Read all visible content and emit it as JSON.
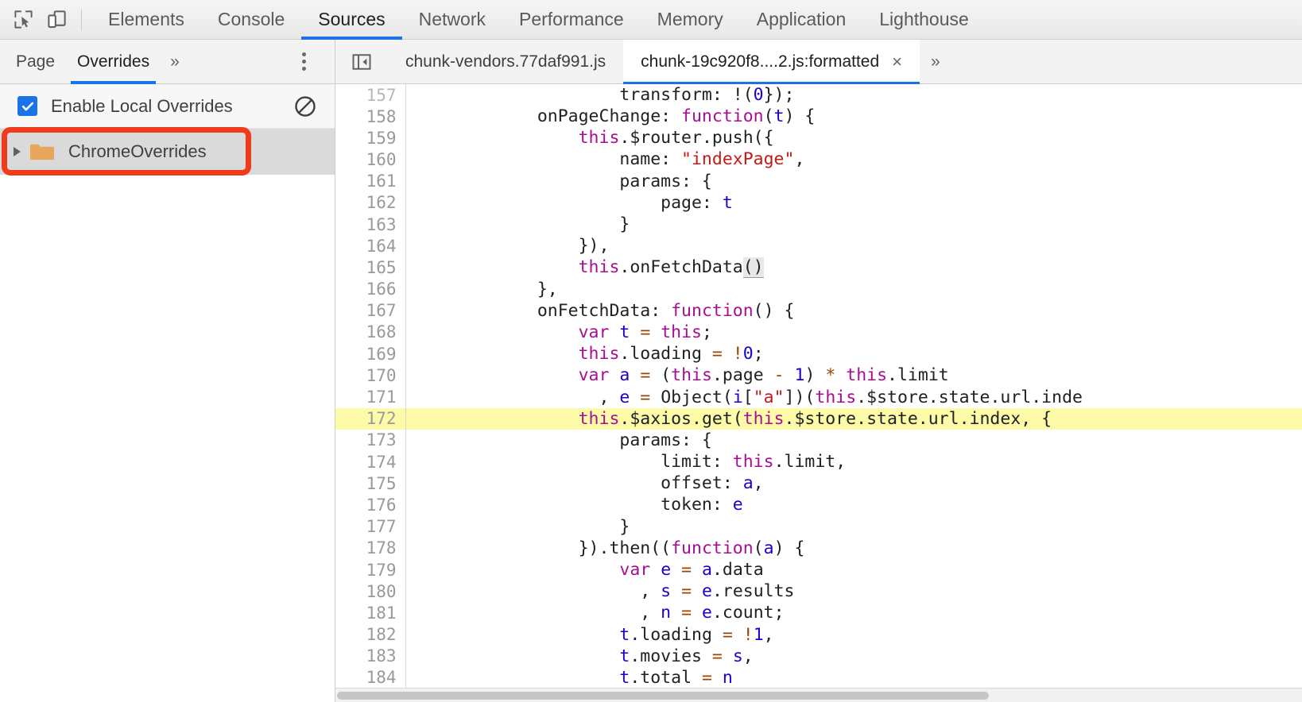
{
  "toolbar": {
    "inspect_icon": "inspect-element-icon",
    "device_icon": "device-toolbar-icon",
    "tabs": [
      {
        "label": "Elements",
        "active": false
      },
      {
        "label": "Console",
        "active": false
      },
      {
        "label": "Sources",
        "active": true
      },
      {
        "label": "Network",
        "active": false
      },
      {
        "label": "Performance",
        "active": false
      },
      {
        "label": "Memory",
        "active": false
      },
      {
        "label": "Application",
        "active": false
      },
      {
        "label": "Lighthouse",
        "active": false
      }
    ]
  },
  "sidebar": {
    "nav_tabs": [
      {
        "label": "Page",
        "active": false
      },
      {
        "label": "Overrides",
        "active": true
      }
    ],
    "more_tabs_label": "»",
    "menu_icon": "more-options-kebab-icon",
    "overrides": {
      "checkbox_label": "Enable Local Overrides",
      "checkbox_checked": true,
      "clear_icon": "clear-configuration-icon",
      "folder": {
        "name": "ChromeOverrides",
        "expanded": false,
        "selected": true,
        "icon": "folder-icon"
      }
    }
  },
  "editor": {
    "nav_back_icon": "show-navigator-icon",
    "tabs": [
      {
        "label": "chunk-vendors.77daf991.js",
        "active": false,
        "closable": false
      },
      {
        "label": "chunk-19c920f8....2.js:formatted",
        "active": true,
        "closable": true,
        "close_label": "×"
      }
    ],
    "overflow_label": "»",
    "highlighted_line": 172,
    "first_line": 157,
    "last_line": 184,
    "lines": [
      {
        "n": 157,
        "clipped": true,
        "tokens": [
          {
            "t": "                    transform: !(",
            "c": "plain"
          },
          {
            "t": "0",
            "c": "num"
          },
          {
            "t": "});",
            "c": "plain"
          }
        ]
      },
      {
        "n": 158,
        "tokens": [
          {
            "t": "            onPageChange: ",
            "c": "plain"
          },
          {
            "t": "function",
            "c": "kw"
          },
          {
            "t": "(",
            "c": "plain"
          },
          {
            "t": "t",
            "c": "idn"
          },
          {
            "t": ") {",
            "c": "plain"
          }
        ]
      },
      {
        "n": 159,
        "tokens": [
          {
            "t": "                ",
            "c": "plain"
          },
          {
            "t": "this",
            "c": "kw"
          },
          {
            "t": ".$router.push({",
            "c": "plain"
          }
        ]
      },
      {
        "n": 160,
        "tokens": [
          {
            "t": "                    name: ",
            "c": "plain"
          },
          {
            "t": "\"indexPage\"",
            "c": "str"
          },
          {
            "t": ",",
            "c": "plain"
          }
        ]
      },
      {
        "n": 161,
        "tokens": [
          {
            "t": "                    params: {",
            "c": "plain"
          }
        ]
      },
      {
        "n": 162,
        "tokens": [
          {
            "t": "                        page: ",
            "c": "plain"
          },
          {
            "t": "t",
            "c": "idn"
          }
        ]
      },
      {
        "n": 163,
        "tokens": [
          {
            "t": "                    }",
            "c": "plain"
          }
        ]
      },
      {
        "n": 164,
        "tokens": [
          {
            "t": "                }),",
            "c": "plain"
          }
        ]
      },
      {
        "n": 165,
        "tokens": [
          {
            "t": "                ",
            "c": "plain"
          },
          {
            "t": "this",
            "c": "kw"
          },
          {
            "t": ".onFetchData",
            "c": "plain"
          },
          {
            "t": "()",
            "c": "callhl"
          }
        ]
      },
      {
        "n": 166,
        "tokens": [
          {
            "t": "            },",
            "c": "plain"
          }
        ]
      },
      {
        "n": 167,
        "tokens": [
          {
            "t": "            onFetchData: ",
            "c": "plain"
          },
          {
            "t": "function",
            "c": "kw"
          },
          {
            "t": "() {",
            "c": "plain"
          }
        ]
      },
      {
        "n": 168,
        "tokens": [
          {
            "t": "                ",
            "c": "plain"
          },
          {
            "t": "var",
            "c": "kw"
          },
          {
            "t": " ",
            "c": "plain"
          },
          {
            "t": "t",
            "c": "idn"
          },
          {
            "t": " ",
            "c": "plain"
          },
          {
            "t": "=",
            "c": "op"
          },
          {
            "t": " ",
            "c": "plain"
          },
          {
            "t": "this",
            "c": "kw"
          },
          {
            "t": ";",
            "c": "plain"
          }
        ]
      },
      {
        "n": 169,
        "tokens": [
          {
            "t": "                ",
            "c": "plain"
          },
          {
            "t": "this",
            "c": "kw"
          },
          {
            "t": ".loading ",
            "c": "plain"
          },
          {
            "t": "=",
            "c": "op"
          },
          {
            "t": " ",
            "c": "plain"
          },
          {
            "t": "!",
            "c": "op"
          },
          {
            "t": "0",
            "c": "num"
          },
          {
            "t": ";",
            "c": "plain"
          }
        ]
      },
      {
        "n": 170,
        "tokens": [
          {
            "t": "                ",
            "c": "plain"
          },
          {
            "t": "var",
            "c": "kw"
          },
          {
            "t": " ",
            "c": "plain"
          },
          {
            "t": "a",
            "c": "idn"
          },
          {
            "t": " ",
            "c": "plain"
          },
          {
            "t": "=",
            "c": "op"
          },
          {
            "t": " (",
            "c": "plain"
          },
          {
            "t": "this",
            "c": "kw"
          },
          {
            "t": ".page ",
            "c": "plain"
          },
          {
            "t": "-",
            "c": "op"
          },
          {
            "t": " ",
            "c": "plain"
          },
          {
            "t": "1",
            "c": "num"
          },
          {
            "t": ") ",
            "c": "plain"
          },
          {
            "t": "*",
            "c": "op"
          },
          {
            "t": " ",
            "c": "plain"
          },
          {
            "t": "this",
            "c": "kw"
          },
          {
            "t": ".limit",
            "c": "plain"
          }
        ]
      },
      {
        "n": 171,
        "tokens": [
          {
            "t": "                  , ",
            "c": "plain"
          },
          {
            "t": "e",
            "c": "idn"
          },
          {
            "t": " ",
            "c": "plain"
          },
          {
            "t": "=",
            "c": "op"
          },
          {
            "t": " Object(",
            "c": "plain"
          },
          {
            "t": "i",
            "c": "idn"
          },
          {
            "t": "[",
            "c": "plain"
          },
          {
            "t": "\"a\"",
            "c": "str"
          },
          {
            "t": "])(",
            "c": "plain"
          },
          {
            "t": "this",
            "c": "kw"
          },
          {
            "t": ".$store.state.url.inde",
            "c": "plain"
          }
        ]
      },
      {
        "n": 172,
        "highlight": true,
        "tokens": [
          {
            "t": "                ",
            "c": "plain"
          },
          {
            "t": "this",
            "c": "kw"
          },
          {
            "t": ".$axios.get(",
            "c": "plain"
          },
          {
            "t": "this",
            "c": "kw"
          },
          {
            "t": ".$store.state.url.index, {",
            "c": "plain"
          }
        ]
      },
      {
        "n": 173,
        "tokens": [
          {
            "t": "                    params: {",
            "c": "plain"
          }
        ]
      },
      {
        "n": 174,
        "tokens": [
          {
            "t": "                        limit: ",
            "c": "plain"
          },
          {
            "t": "this",
            "c": "kw"
          },
          {
            "t": ".limit,",
            "c": "plain"
          }
        ]
      },
      {
        "n": 175,
        "tokens": [
          {
            "t": "                        offset: ",
            "c": "plain"
          },
          {
            "t": "a",
            "c": "idn"
          },
          {
            "t": ",",
            "c": "plain"
          }
        ]
      },
      {
        "n": 176,
        "tokens": [
          {
            "t": "                        token: ",
            "c": "plain"
          },
          {
            "t": "e",
            "c": "idn"
          }
        ]
      },
      {
        "n": 177,
        "tokens": [
          {
            "t": "                    }",
            "c": "plain"
          }
        ]
      },
      {
        "n": 178,
        "tokens": [
          {
            "t": "                }).then((",
            "c": "plain"
          },
          {
            "t": "function",
            "c": "kw"
          },
          {
            "t": "(",
            "c": "plain"
          },
          {
            "t": "a",
            "c": "idn"
          },
          {
            "t": ") {",
            "c": "plain"
          }
        ]
      },
      {
        "n": 179,
        "tokens": [
          {
            "t": "                    ",
            "c": "plain"
          },
          {
            "t": "var",
            "c": "kw"
          },
          {
            "t": " ",
            "c": "plain"
          },
          {
            "t": "e",
            "c": "idn"
          },
          {
            "t": " ",
            "c": "plain"
          },
          {
            "t": "=",
            "c": "op"
          },
          {
            "t": " ",
            "c": "plain"
          },
          {
            "t": "a",
            "c": "idn"
          },
          {
            "t": ".data",
            "c": "plain"
          }
        ]
      },
      {
        "n": 180,
        "tokens": [
          {
            "t": "                      , ",
            "c": "plain"
          },
          {
            "t": "s",
            "c": "idn"
          },
          {
            "t": " ",
            "c": "plain"
          },
          {
            "t": "=",
            "c": "op"
          },
          {
            "t": " ",
            "c": "plain"
          },
          {
            "t": "e",
            "c": "idn"
          },
          {
            "t": ".results",
            "c": "plain"
          }
        ]
      },
      {
        "n": 181,
        "tokens": [
          {
            "t": "                      , ",
            "c": "plain"
          },
          {
            "t": "n",
            "c": "idn"
          },
          {
            "t": " ",
            "c": "plain"
          },
          {
            "t": "=",
            "c": "op"
          },
          {
            "t": " ",
            "c": "plain"
          },
          {
            "t": "e",
            "c": "idn"
          },
          {
            "t": ".count;",
            "c": "plain"
          }
        ]
      },
      {
        "n": 182,
        "tokens": [
          {
            "t": "                    ",
            "c": "plain"
          },
          {
            "t": "t",
            "c": "idn"
          },
          {
            "t": ".loading ",
            "c": "plain"
          },
          {
            "t": "=",
            "c": "op"
          },
          {
            "t": " ",
            "c": "plain"
          },
          {
            "t": "!",
            "c": "op"
          },
          {
            "t": "1",
            "c": "num"
          },
          {
            "t": ",",
            "c": "plain"
          }
        ]
      },
      {
        "n": 183,
        "tokens": [
          {
            "t": "                    ",
            "c": "plain"
          },
          {
            "t": "t",
            "c": "idn"
          },
          {
            "t": ".movies ",
            "c": "plain"
          },
          {
            "t": "=",
            "c": "op"
          },
          {
            "t": " ",
            "c": "plain"
          },
          {
            "t": "s",
            "c": "idn"
          },
          {
            "t": ",",
            "c": "plain"
          }
        ]
      },
      {
        "n": 184,
        "tokens": [
          {
            "t": "                    ",
            "c": "plain"
          },
          {
            "t": "t",
            "c": "idn"
          },
          {
            "t": ".total ",
            "c": "plain"
          },
          {
            "t": "=",
            "c": "op"
          },
          {
            "t": " ",
            "c": "plain"
          },
          {
            "t": "n",
            "c": "idn"
          }
        ]
      }
    ]
  },
  "annotation": {
    "shape": "rectangle",
    "color": "#ef3b1c",
    "target": "ChromeOverrides"
  },
  "colors": {
    "accent": "#1a73e8",
    "annotation": "#ef3b1c",
    "highlight_line": "#fdfba8",
    "keyword": "#aa0d91",
    "string": "#c41a16",
    "number": "#1c00cf",
    "operator": "#994500",
    "folder": "#e8a55c"
  }
}
